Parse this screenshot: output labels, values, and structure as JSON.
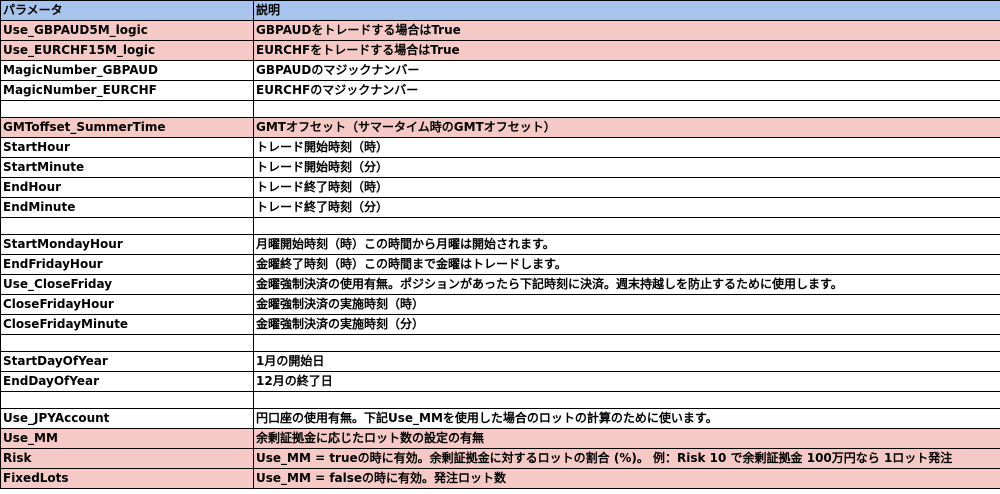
{
  "table": {
    "headers": [
      "パラメータ",
      "説明"
    ],
    "header_color": "#a7c4ec",
    "highlight_color": "#f5c9c5",
    "rows": [
      {
        "param": "Use_GBPAUD5M_logic",
        "desc": "GBPAUDをトレードする場合はTrue",
        "highlight": true
      },
      {
        "param": "Use_EURCHF15M_logic",
        "desc": "EURCHFをトレードする場合はTrue",
        "highlight": true
      },
      {
        "param": "MagicNumber_GBPAUD",
        "desc": "GBPAUDのマジックナンバー",
        "highlight": false
      },
      {
        "param": "MagicNumber_EURCHF",
        "desc": "EURCHFのマジックナンバー",
        "highlight": false
      },
      {
        "param": "",
        "desc": "",
        "highlight": false,
        "spacer": true
      },
      {
        "param": "GMToffset_SummerTime",
        "desc": "GMTオフセット（サマータイム時のGMTオフセット）",
        "highlight": true
      },
      {
        "param": "StartHour",
        "desc": "トレード開始時刻（時）",
        "highlight": false
      },
      {
        "param": "StartMinute",
        "desc": "トレード開始時刻（分）",
        "highlight": false
      },
      {
        "param": "EndHour",
        "desc": "トレード終了時刻（時）",
        "highlight": false
      },
      {
        "param": "EndMinute",
        "desc": "トレード終了時刻（分）",
        "highlight": false
      },
      {
        "param": "",
        "desc": "",
        "highlight": false,
        "spacer": true
      },
      {
        "param": "StartMondayHour",
        "desc": "月曜開始時刻（時）この時間から月曜は開始されます。",
        "highlight": false
      },
      {
        "param": "EndFridayHour",
        "desc": "金曜終了時刻（時）この時間まで金曜はトレードします。",
        "highlight": false
      },
      {
        "param": "Use_CloseFriday",
        "desc": "金曜強制決済の使用有無。ポジションがあったら下記時刻に決済。週末持越しを防止するために使用します。",
        "highlight": false
      },
      {
        "param": "CloseFridayHour",
        "desc": "金曜強制決済の実施時刻（時）",
        "highlight": false
      },
      {
        "param": "CloseFridayMinute",
        "desc": "金曜強制決済の実施時刻（分）",
        "highlight": false
      },
      {
        "param": "",
        "desc": "",
        "highlight": false,
        "spacer": true
      },
      {
        "param": "StartDayOfYear",
        "desc": "1月の開始日",
        "highlight": false
      },
      {
        "param": "EndDayOfYear",
        "desc": "12月の終了日",
        "highlight": false
      },
      {
        "param": "",
        "desc": "",
        "highlight": false,
        "spacer": true
      },
      {
        "param": "Use_JPYAccount",
        "desc": "円口座の使用有無。下記Use_MMを使用した場合のロットの計算のために使います。",
        "highlight": false
      },
      {
        "param": "Use_MM",
        "desc": "余剰証拠金に応じたロット数の設定の有無",
        "highlight": true
      },
      {
        "param": "Risk",
        "desc": "Use_MM = trueの時に有効。余剰証拠金に対するロットの割合 (%)。 例：Risk 10 で余剰証拠金 100万円なら 1ロット発注",
        "highlight": true
      },
      {
        "param": "FixedLots",
        "desc": "Use_MM = falseの時に有効。発注ロット数",
        "highlight": true
      }
    ]
  }
}
